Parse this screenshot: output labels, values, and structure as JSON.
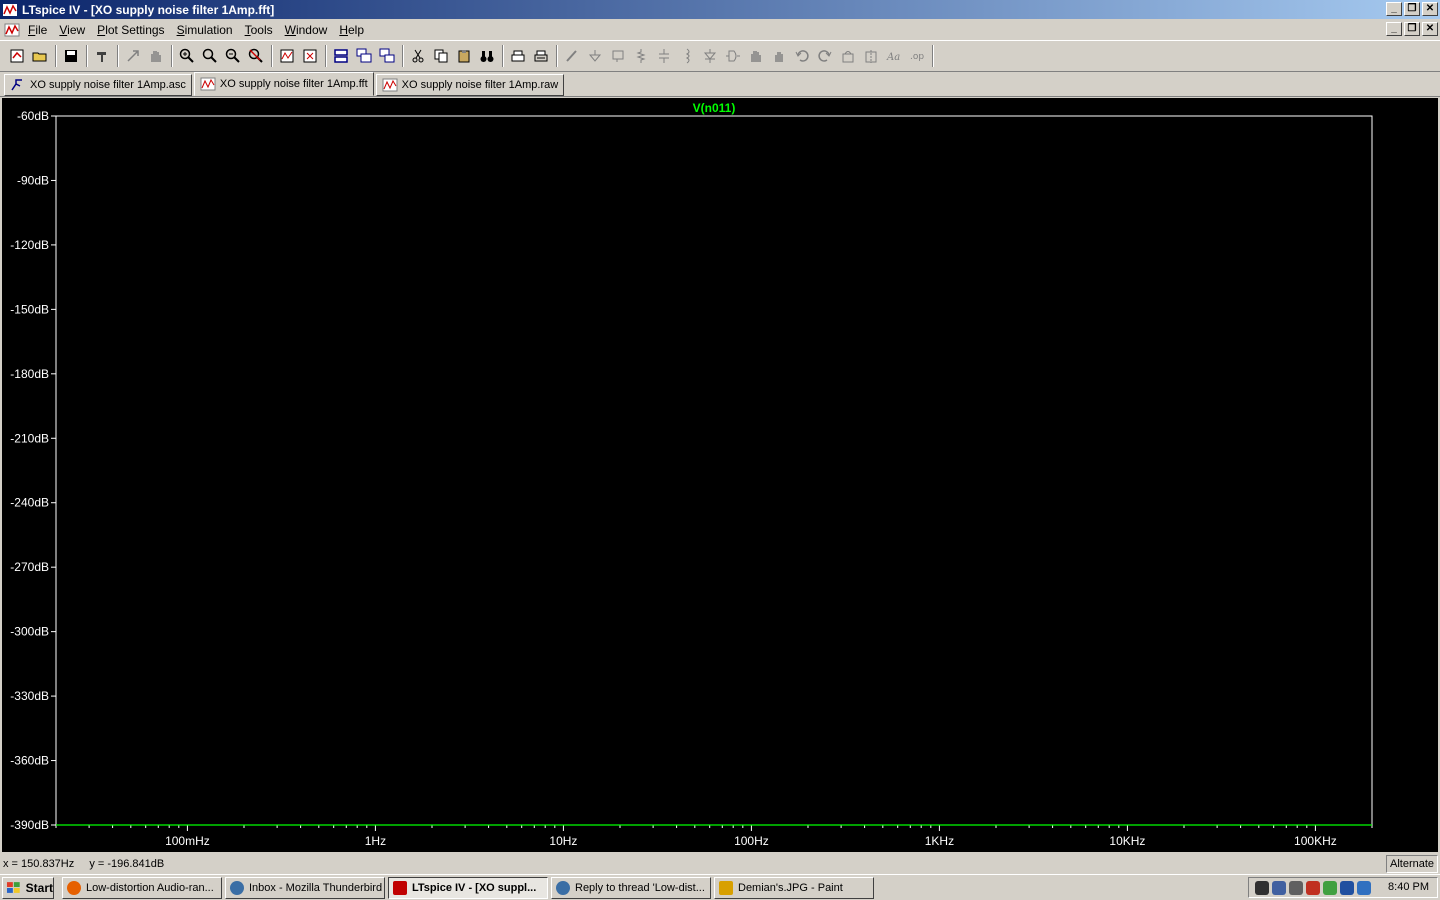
{
  "window": {
    "title": "LTspice IV - [XO supply noise filter 1Amp.fft]",
    "minimize": "_",
    "restore": "❐",
    "close": "✕"
  },
  "menu": [
    "File",
    "View",
    "Plot Settings",
    "Simulation",
    "Tools",
    "Window",
    "Help"
  ],
  "tabs": [
    {
      "label": "XO supply noise filter 1Amp.asc",
      "icon": "schematic-icon",
      "active": false
    },
    {
      "label": "XO supply noise filter 1Amp.fft",
      "icon": "waveform-icon",
      "active": true
    },
    {
      "label": "XO supply noise filter 1Amp.raw",
      "icon": "waveform-icon",
      "active": false
    }
  ],
  "chart_data": {
    "type": "line",
    "title": "V(n011)",
    "x_scale": "log",
    "xlim": [
      0.02,
      200000
    ],
    "ylim": [
      -390,
      -60
    ],
    "x_ticks": [
      {
        "value": 0.1,
        "label": "100mHz"
      },
      {
        "value": 1,
        "label": "1Hz"
      },
      {
        "value": 10,
        "label": "10Hz"
      },
      {
        "value": 100,
        "label": "100Hz"
      },
      {
        "value": 1000,
        "label": "1KHz"
      },
      {
        "value": 10000,
        "label": "10KHz"
      },
      {
        "value": 100000,
        "label": "100KHz"
      }
    ],
    "y_ticks": [
      {
        "value": -60,
        "label": "-60dB"
      },
      {
        "value": -90,
        "label": "-90dB"
      },
      {
        "value": -120,
        "label": "-120dB"
      },
      {
        "value": -150,
        "label": "-150dB"
      },
      {
        "value": -180,
        "label": "-180dB"
      },
      {
        "value": -210,
        "label": "-210dB"
      },
      {
        "value": -240,
        "label": "-240dB"
      },
      {
        "value": -270,
        "label": "-270dB"
      },
      {
        "value": -300,
        "label": "-300dB"
      },
      {
        "value": -330,
        "label": "-330dB"
      },
      {
        "value": -360,
        "label": "-360dB"
      },
      {
        "value": -390,
        "label": "-390dB"
      }
    ],
    "series": [
      {
        "name": "V(n011)",
        "color": "#00ff00",
        "x": [
          0.02,
          200000
        ],
        "y": [
          -390,
          -390
        ]
      }
    ],
    "grid": false,
    "background": "#000000",
    "axis_color": "#ffffff",
    "series_color": "#00ff00"
  },
  "status": {
    "x_readout": "x = 150.837Hz",
    "y_readout": "y = -196.841dB",
    "mode": "Alternate"
  },
  "taskbar": {
    "start": "Start",
    "tasks": [
      {
        "label": "Low-distortion Audio-ran...",
        "color": "#e66000",
        "active": false
      },
      {
        "label": "Inbox - Mozilla Thunderbird",
        "color": "#3a6ea5",
        "active": false
      },
      {
        "label": "LTspice IV - [XO suppl...",
        "color": "#c00000",
        "active": true
      },
      {
        "label": "Reply to thread 'Low-dist...",
        "color": "#3a6ea5",
        "active": false
      },
      {
        "label": "Demian's.JPG - Paint",
        "color": "#d8a000",
        "active": false
      }
    ],
    "clock": "8:40 PM"
  }
}
